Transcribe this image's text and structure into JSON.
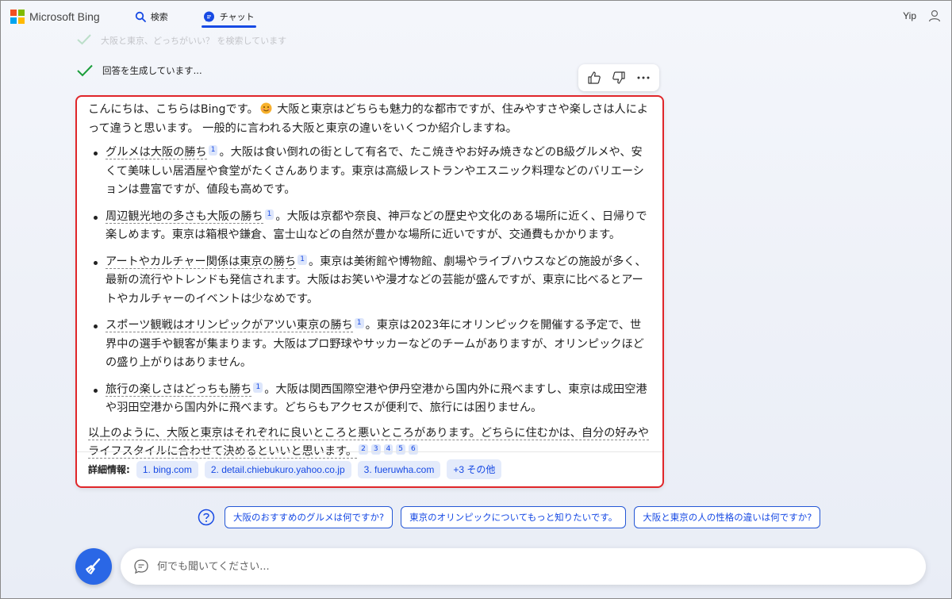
{
  "header": {
    "brand": "Microsoft Bing",
    "tabs": [
      {
        "label": "検索",
        "icon": "search-icon"
      },
      {
        "label": "チャット",
        "icon": "chat-icon",
        "active": true
      }
    ],
    "user_name": "Yip"
  },
  "status": {
    "faded_text": "大阪と東京、どっちがいい？ を検索しています",
    "generating_text": "回答を生成しています..."
  },
  "answer": {
    "intro": "こんにちは、こちらはBingです。 大阪と東京はどちらも魅力的な都市ですが、住みやすさや楽しさは人によって違うと思います。 一般的に言われる大阪と東京の違いをいくつか紹介しますね。",
    "intro_a": "こんにちは、こちらはBingです。",
    "intro_b": " 大阪と東京はどちらも魅力的な都市ですが、住みやすさや楽しさは人によって違うと思います。 一般的に言われる大阪と東京の違いをいくつか紹介しますね。",
    "points": [
      {
        "head": "グルメは大阪の勝ち",
        "cite": "1",
        "body": "。大阪は食い倒れの街として有名で、たこ焼きやお好み焼きなどのB級グルメや、安くて美味しい居酒屋や食堂がたくさんあります。東京は高級レストランやエスニック料理などのバリエーションは豊富ですが、値段も高めです。"
      },
      {
        "head": "周辺観光地の多さも大阪の勝ち",
        "cite": "1",
        "body": "。大阪は京都や奈良、神戸などの歴史や文化のある場所に近く、日帰りで楽しめます。東京は箱根や鎌倉、富士山などの自然が豊かな場所に近いですが、交通費もかかります。"
      },
      {
        "head": "アートやカルチャー関係は東京の勝ち",
        "cite": "1",
        "body": "。東京は美術館や博物館、劇場やライブハウスなどの施設が多く、最新の流行やトレンドも発信されます。大阪はお笑いや漫才などの芸能が盛んですが、東京に比べるとアートやカルチャーのイベントは少なめです。"
      },
      {
        "head": "スポーツ観戦はオリンピックがアツい東京の勝ち",
        "cite": "1",
        "body": "。東京は2023年にオリンピックを開催する予定で、世界中の選手や観客が集まります。大阪はプロ野球やサッカーなどのチームがありますが、オリンピックほどの盛り上がりはありません。"
      },
      {
        "head": "旅行の楽しさはどっちも勝ち",
        "cite": "1",
        "body": "。大阪は関西国際空港や伊丹空港から国内外に飛べますし、東京は成田空港や羽田空港から国内外に飛べます。どちらもアクセスが便利で、旅行には困りません。"
      }
    ],
    "outro": "以上のように、大阪と東京はそれぞれに良いところと悪いところがあります。どちらに住むかは、自分の好みやライフスタイルに合わせて決めるといいと思います。",
    "outro_cites": [
      "2",
      "3",
      "4",
      "5",
      "6"
    ],
    "sources_label": "詳細情報:",
    "sources": [
      "1. bing.com",
      "2. detail.chiebukuro.yahoo.co.jp",
      "3. fueruwha.com",
      "+3 その他"
    ]
  },
  "suggestions": [
    "大阪のおすすめのグルメは何ですか?",
    "東京のオリンピックについてもっと知りたいです。",
    "大阪と東京の人の性格の違いは何ですか?"
  ],
  "compose": {
    "placeholder": "何でも聞いてください..."
  },
  "colors": {
    "accent": "#174ae4",
    "highlight_border": "#e0262a",
    "check": "#1a9e3a"
  }
}
